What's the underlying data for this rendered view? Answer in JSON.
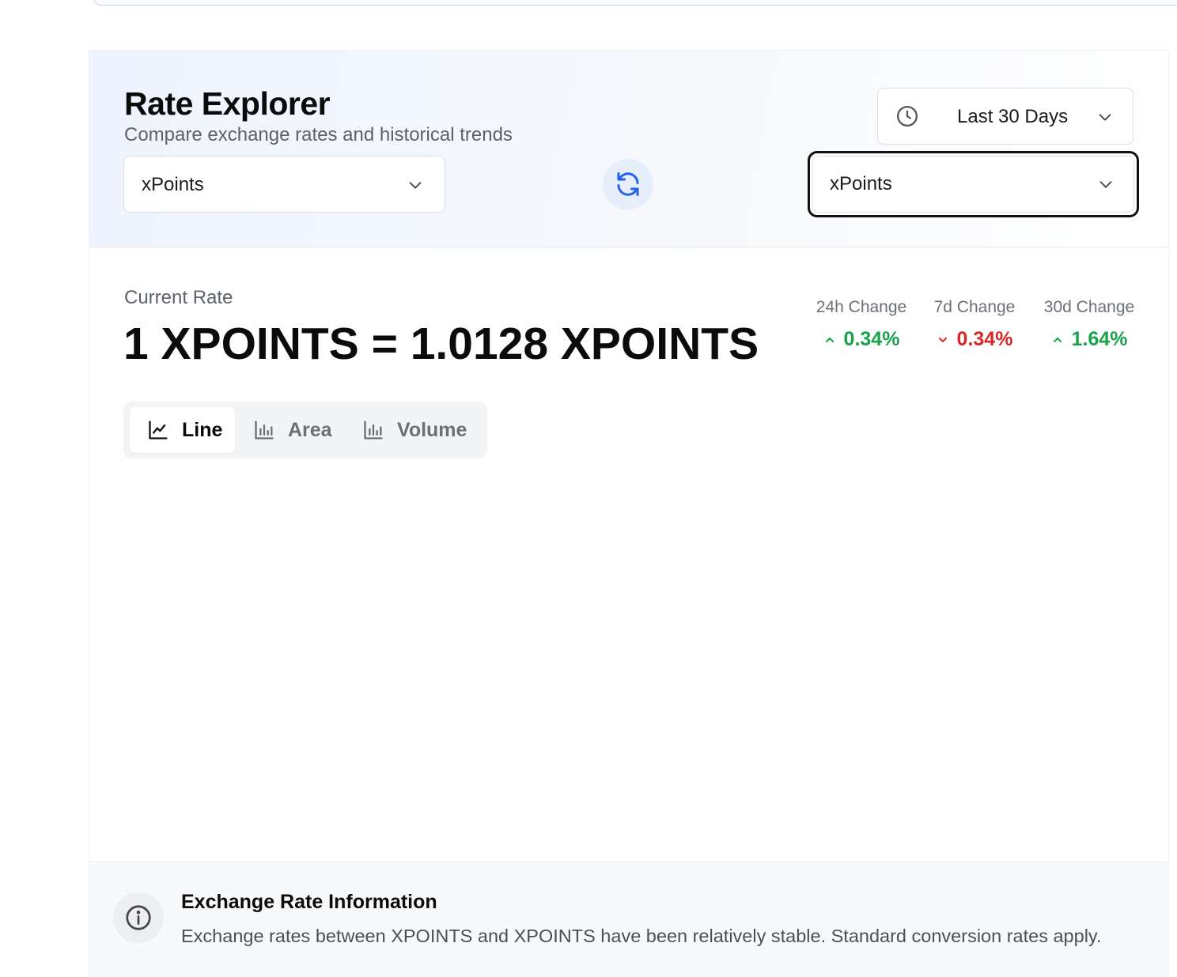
{
  "header": {
    "title": "Rate Explorer",
    "subtitle": "Compare exchange rates and historical trends"
  },
  "period_select": {
    "value": "Last 30 Days",
    "icon": "clock-icon"
  },
  "from_currency": {
    "value": "xPoints"
  },
  "to_currency": {
    "value": "xPoints"
  },
  "swap_button": {
    "icon": "refresh-icon",
    "color": "#2563eb"
  },
  "current_rate": {
    "label": "Current Rate",
    "value": "1 XPOINTS = 1.0128 XPOINTS"
  },
  "changes": [
    {
      "label": "24h Change",
      "value": "0.34%",
      "direction": "up",
      "color": "#17a34a"
    },
    {
      "label": "7d Change",
      "value": "0.34%",
      "direction": "down",
      "color": "#dc2626"
    },
    {
      "label": "30d Change",
      "value": "1.64%",
      "direction": "up",
      "color": "#17a34a"
    }
  ],
  "chart_tabs": [
    {
      "label": "Line",
      "icon": "line-chart-icon",
      "active": true
    },
    {
      "label": "Area",
      "icon": "bar-chart-icon",
      "active": false
    },
    {
      "label": "Volume",
      "icon": "bar-chart-icon",
      "active": false
    }
  ],
  "info": {
    "title": "Exchange Rate Information",
    "text": "Exchange rates between XPOINTS and XPOINTS have been relatively stable. Standard conversion rates apply.",
    "icon": "info-icon"
  }
}
